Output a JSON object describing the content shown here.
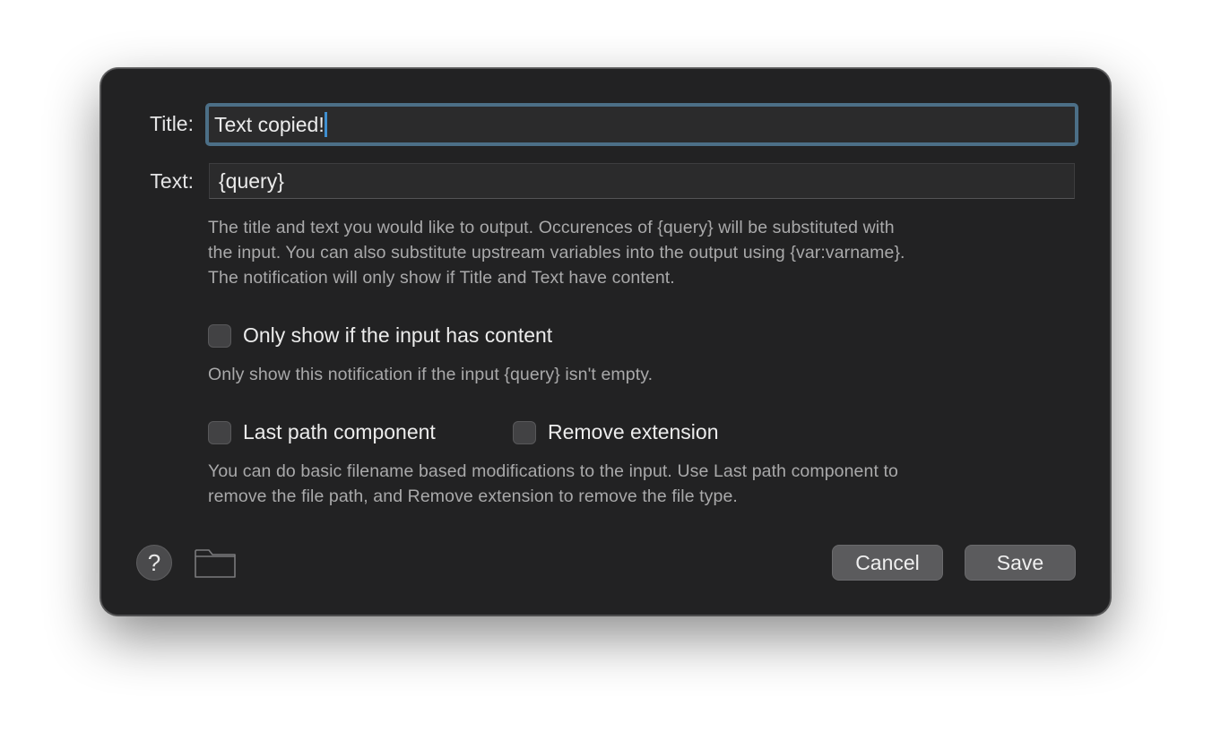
{
  "form": {
    "title_label": "Title:",
    "title_value": "Text copied!",
    "text_label": "Text:",
    "text_value": "{query}",
    "output_help": [
      "The title and text you would like to output. Occurences of {query} will be substituted with",
      "the input. You can also substitute upstream variables into the output using {var:varname}.",
      "The notification will only show if Title and Text have content."
    ]
  },
  "options": {
    "only_show_label": "Only show if the input has content",
    "only_show_checked": false,
    "only_show_help": "Only show this notification if the input {query} isn't empty.",
    "last_path_label": "Last path component",
    "last_path_checked": false,
    "remove_ext_label": "Remove extension",
    "remove_ext_checked": false,
    "filename_help": [
      "You can do basic filename based modifications to the input. Use Last path component to",
      "remove the file path, and Remove extension to remove the file type."
    ]
  },
  "footer": {
    "help_glyph": "?",
    "help_icon": "question-icon",
    "folder_icon": "folder-icon",
    "cancel_label": "Cancel",
    "save_label": "Save"
  },
  "colors": {
    "dialog_bg": "#222223",
    "focus_ring": "#4c6f87",
    "caret": "#3f8fd0"
  }
}
